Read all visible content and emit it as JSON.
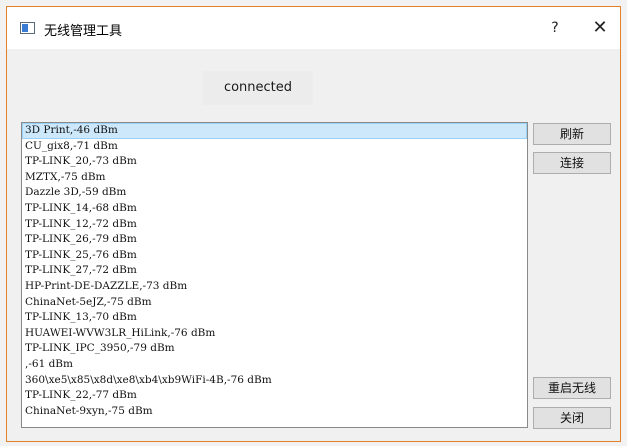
{
  "window": {
    "title": "无线管理工具",
    "help_glyph": "?",
    "close_glyph": "✕"
  },
  "status": {
    "text": "connected"
  },
  "networks": [
    "3D Print,-46 dBm",
    "CU_gix8,-71 dBm",
    "TP-LINK_20,-73 dBm",
    "MZTX,-75 dBm",
    "Dazzle 3D,-59 dBm",
    "TP-LINK_14,-68 dBm",
    "TP-LINK_12,-72 dBm",
    "TP-LINK_26,-79 dBm",
    "TP-LINK_25,-76 dBm",
    "TP-LINK_27,-72 dBm",
    "HP-Print-DE-DAZZLE,-73 dBm",
    "ChinaNet-5eJZ,-75 dBm",
    "TP-LINK_13,-70 dBm",
    "HUAWEI-WVW3LR_HiLink,-76 dBm",
    "TP-LINK_IPC_3950,-79 dBm",
    ",-61 dBm",
    "360\\xe5\\x85\\x8d\\xe8\\xb4\\xb9WiFi-4B,-76 dBm",
    "TP-LINK_22,-77 dBm",
    "ChinaNet-9xyn,-75 dBm"
  ],
  "buttons": {
    "refresh": "刷新",
    "connect": "连接",
    "restart_wireless": "重启无线",
    "close": "关闭"
  },
  "colors": {
    "window_border": "#e0822c",
    "selection_bg": "#cde8fb"
  }
}
